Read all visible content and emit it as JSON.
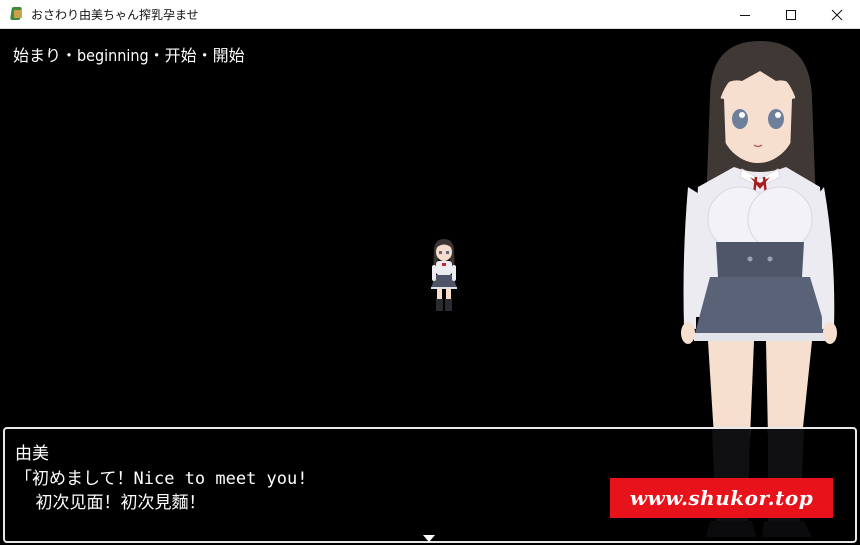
{
  "window": {
    "title": "おさわり由美ちゃん搾乳孕ませ",
    "icon": "app-icon",
    "controls": [
      "minimize-icon",
      "maximize-icon",
      "close-icon"
    ]
  },
  "game": {
    "map_name": "始まり・beginning・开始・開始",
    "message": {
      "speaker": "由美",
      "line1": "「初めまして！Nice to meet you!",
      "line2": "  初次见面！初次見麵！",
      "continue_indicator": "down-triangle-icon"
    },
    "watermark": "www.shukor.top",
    "colors": {
      "background": "#000000",
      "watermark_bg": "#e8131a",
      "text": "#ffffff"
    }
  }
}
